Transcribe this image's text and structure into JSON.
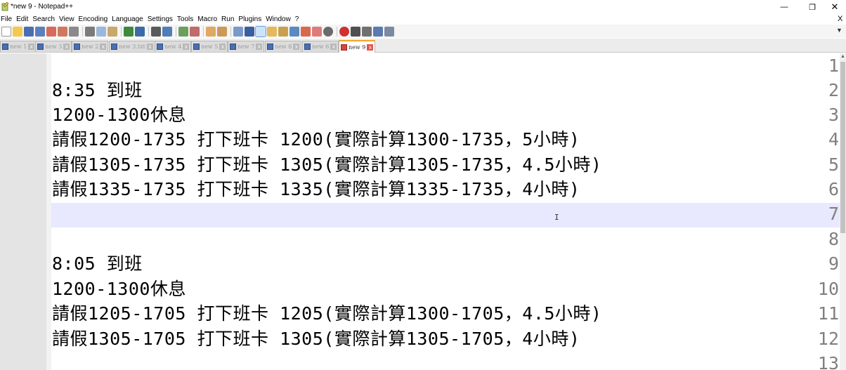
{
  "window": {
    "title": "*new 9 - Notepad++",
    "minimize_glyph": "—",
    "maximize_glyph": "❐",
    "close_glyph": "✕"
  },
  "menu": {
    "items": [
      "File",
      "Edit",
      "Search",
      "View",
      "Encoding",
      "Language",
      "Settings",
      "Tools",
      "Macro",
      "Run",
      "Plugins",
      "Window",
      "?"
    ],
    "close_glyph": "X"
  },
  "tabs": [
    {
      "label": "new 1"
    },
    {
      "label": "new 3"
    },
    {
      "label": "new 2"
    },
    {
      "label": "new 3.txt"
    },
    {
      "label": "new 4"
    },
    {
      "label": "new 5"
    },
    {
      "label": "new 7"
    },
    {
      "label": "new 8"
    },
    {
      "label": "new 6"
    },
    {
      "label": "new 9",
      "active": true
    }
  ],
  "tab_close_glyph": "x",
  "editor": {
    "line_numbers": [
      "1",
      "2",
      "3",
      "4",
      "5",
      "6",
      "7",
      "8",
      "9",
      "10",
      "11",
      "12",
      "13"
    ],
    "lines": [
      "",
      "8:35 到班",
      "1200-1300休息",
      "請假1200-1735 打下班卡 1200(實際計算1300-1735，5小時)",
      "請假1305-1735 打下班卡 1305(實際計算1305-1735，4.5小時)",
      "請假1335-1735 打下班卡 1335(實際計算1335-1735，4小時)",
      "",
      "",
      "8:05 到班",
      "1200-1300休息",
      "請假1205-1705 打下班卡 1205(實際計算1300-1705，4.5小時)",
      "請假1305-1705 打下班卡 1305(實際計算1305-1705，4小時)",
      ""
    ],
    "current_line": 7,
    "cursor_glyph": "I"
  },
  "colors": {
    "current_line_bg": "#e8e8ff",
    "gutter_bg": "#e4e4e4",
    "line_number_fg": "#808080",
    "active_tab_accent": "#f5a623"
  }
}
